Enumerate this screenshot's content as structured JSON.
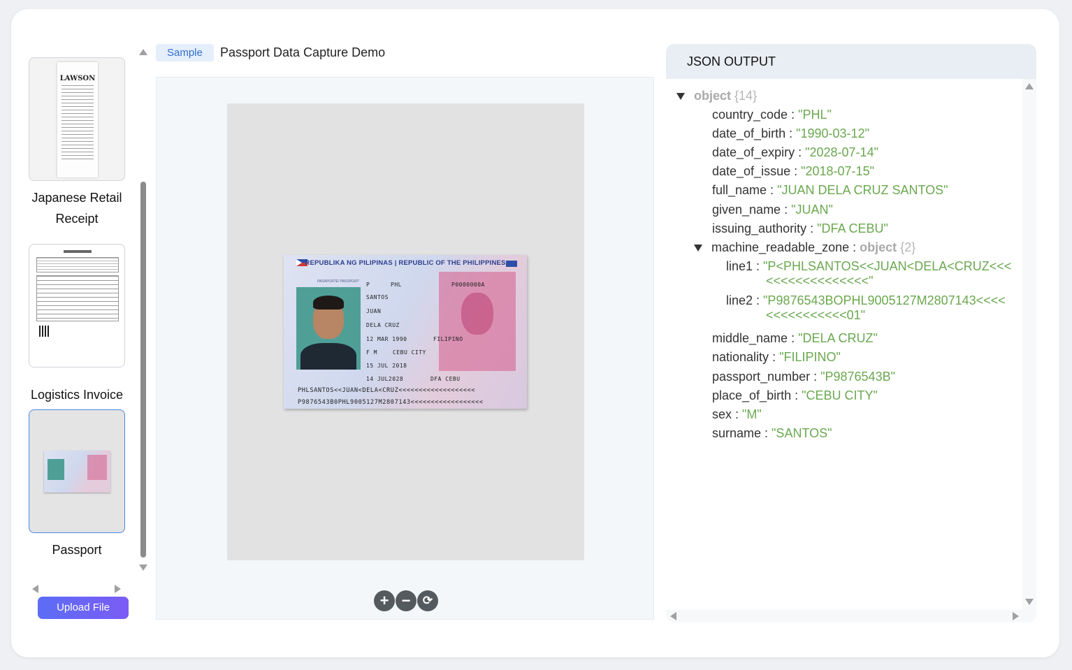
{
  "samples": [
    {
      "label": "Japanese Retail Receipt",
      "thumb_text": "LAWSON"
    },
    {
      "label": "Logistics Invoice"
    },
    {
      "label": "Passport"
    }
  ],
  "upload_label": "Upload File",
  "header": {
    "tag": "Sample",
    "title": "Passport Data Capture Demo"
  },
  "viewer": {
    "zoom_in": "+",
    "zoom_out": "−",
    "reset": "⟳"
  },
  "passport_image": {
    "header": "REPUBLIKA NG PILIPINAS | REPUBLIC OF THE PHILIPPINES",
    "type_label": "PASAPORTE/ PASSPORT",
    "type_value": "P",
    "code_value": "PHL",
    "number_value": "P0000000A",
    "surname": "SANTOS",
    "given": "JUAN",
    "middle": "DELA CRUZ",
    "dob": "12 MAR 1990",
    "nationality": "FILIPINO",
    "sex": "F M",
    "pob": "CEBU CITY",
    "issue": "15 JUL 2018",
    "expiry": "14 JUL2028",
    "authority": "DFA CEBU",
    "mrz1": "PHLSANTOS<<JUAN<DELA<CRUZ<<<<<<<<<<<<<<<<<<<",
    "mrz2": "P9876543B0PHL9005127M2807143<<<<<<<<<<<<<<<<<<"
  },
  "json_output": {
    "title": "JSON OUTPUT",
    "root_type": "object",
    "root_count": "{14}",
    "fields": [
      {
        "key": "country_code",
        "value": "\"PHL\""
      },
      {
        "key": "date_of_birth",
        "value": "\"1990-03-12\""
      },
      {
        "key": "date_of_expiry",
        "value": "\"2028-07-14\""
      },
      {
        "key": "date_of_issue",
        "value": "\"2018-07-15\""
      },
      {
        "key": "full_name",
        "value": "\"JUAN DELA CRUZ SANTOS\""
      },
      {
        "key": "given_name",
        "value": "\"JUAN\""
      },
      {
        "key": "issuing_authority",
        "value": "\"DFA CEBU\""
      }
    ],
    "mrz": {
      "key": "machine_readable_zone",
      "type": "object",
      "count": "{2}",
      "line1_key": "line1",
      "line1_a": "\"P<PHLSANTOS<<JUAN<DELA<CRUZ<<<",
      "line1_b": "<<<<<<<<<<<<<<\"",
      "line2_key": "line2",
      "line2_a": "\"P9876543BOPHL9005127M2807143<<<<",
      "line2_b": "<<<<<<<<<<<01\""
    },
    "fields2": [
      {
        "key": "middle_name",
        "value": "\"DELA CRUZ\""
      },
      {
        "key": "nationality",
        "value": "\"FILIPINO\""
      },
      {
        "key": "passport_number",
        "value": "\"P9876543B\""
      },
      {
        "key": "place_of_birth",
        "value": "\"CEBU CITY\""
      },
      {
        "key": "sex",
        "value": "\"M\""
      },
      {
        "key": "surname",
        "value": "\"SANTOS\""
      }
    ]
  },
  "colors": {
    "accent": "#4a86e8",
    "string": "#6aa84f",
    "tag_bg": "#e5eefb"
  }
}
